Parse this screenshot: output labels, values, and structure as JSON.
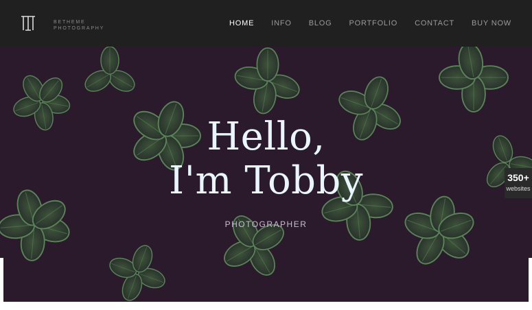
{
  "header": {
    "brand_line1": "BETHEME",
    "brand_line2": "PHOTOGRAPHY",
    "nav": [
      "HOME",
      "INFO",
      "BLOG",
      "PORTFOLIO",
      "CONTACT",
      "BUY NOW"
    ],
    "active_nav": "HOME"
  },
  "hero": {
    "title_line1": "Hello,",
    "title_line2": "I'm Tobby",
    "subtitle": "PHOTOGRAPHER",
    "background": "dark purple with green succulent leaves"
  },
  "badge": {
    "count": "350+",
    "label": "websites"
  },
  "colors": {
    "header_bg": "#202020",
    "hero_bg": "#2b1c2c",
    "leaf": "#3f6b3f",
    "leaf_edge": "#7fcf7a",
    "title": "#e9f5ff"
  }
}
